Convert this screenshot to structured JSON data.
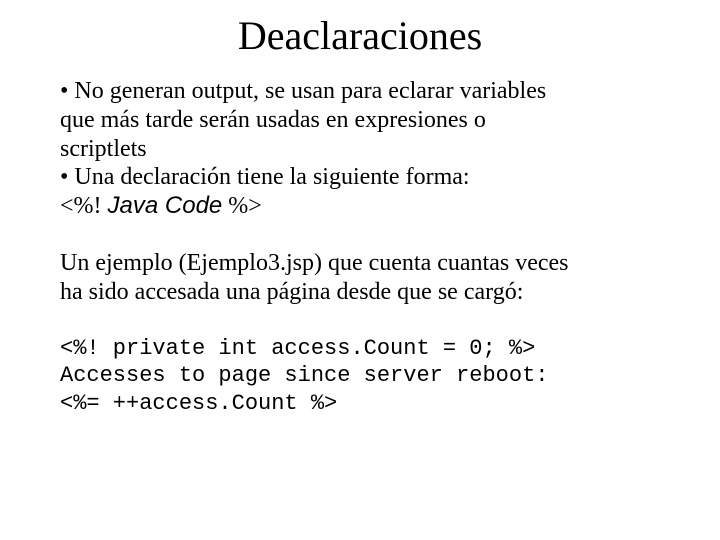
{
  "title": "Deaclaraciones",
  "bullets": {
    "b1_l1": "• No generan output, se usan para eclarar variables",
    "b1_l2": "que más tarde serán usadas en expresiones o",
    "b1_l3": "scriptlets",
    "b2_l1": "• Una declaración tiene la siguiente forma:",
    "syntax_open": "<%! ",
    "syntax_java": "Java Code",
    "syntax_close": " %>"
  },
  "example": {
    "l1": "Un ejemplo (Ejemplo3.jsp) que cuenta cuantas veces",
    "l2": "ha sido accesada una página desde que se cargó:"
  },
  "code": {
    "l1": "<%! private int access.Count = 0; %>",
    "l2": "Accesses to page since server reboot:",
    "l3": "<%= ++access.Count %>"
  }
}
